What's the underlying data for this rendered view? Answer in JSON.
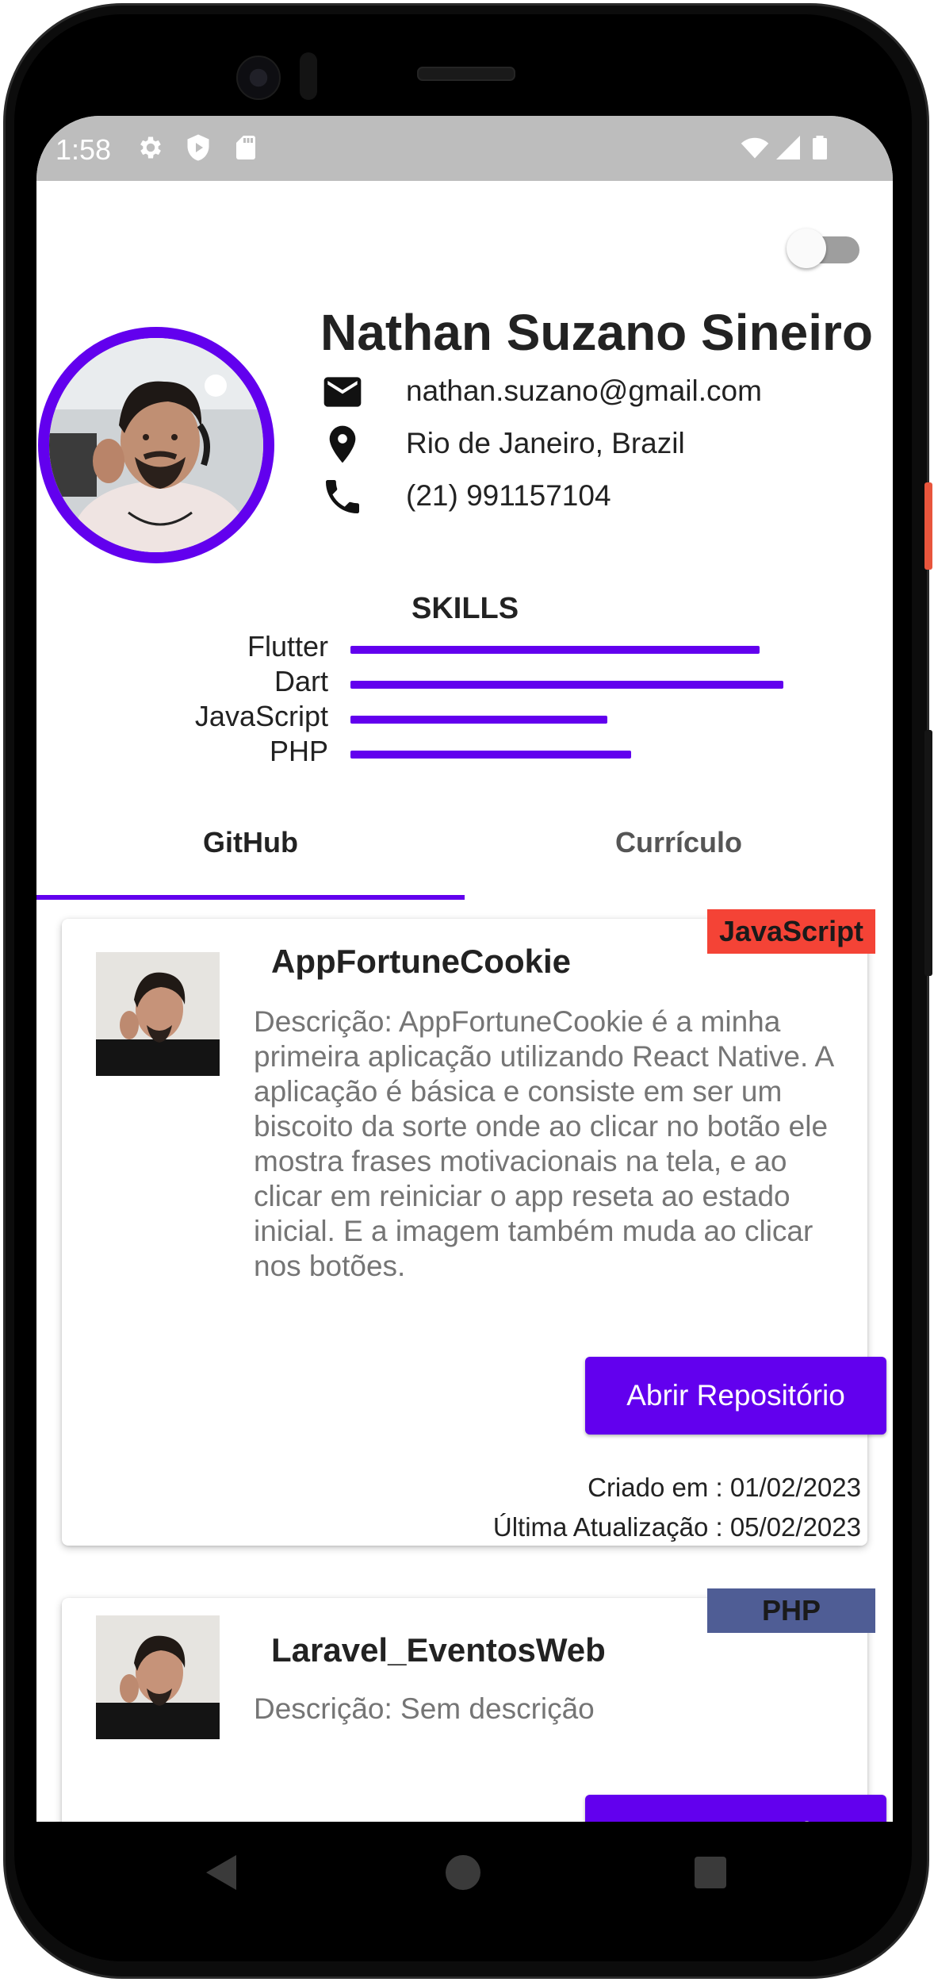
{
  "status_bar": {
    "time": "1:58",
    "left_icons": [
      "settings-icon",
      "shield-play-icon",
      "sd-card-icon"
    ],
    "right_icons": [
      "wifi-icon",
      "signal-icon",
      "battery-icon"
    ]
  },
  "theme_toggle": {
    "on": false
  },
  "profile": {
    "name": "Nathan Suzano Sineiro",
    "email": "nathan.suzano@gmail.com",
    "location": "Rio de Janeiro, Brazil",
    "phone": "(21) 991157104"
  },
  "skills": {
    "title": "SKILLS",
    "items": [
      {
        "label": "Flutter",
        "level": 0.86
      },
      {
        "label": "Dart",
        "level": 0.91
      },
      {
        "label": "JavaScript",
        "level": 0.54
      },
      {
        "label": "PHP",
        "level": 0.59
      }
    ]
  },
  "tabs": [
    {
      "label": "GitHub",
      "active": true
    },
    {
      "label": "Currículo",
      "active": false
    }
  ],
  "repos": [
    {
      "title": "AppFortuneCookie",
      "language": "JavaScript",
      "language_color": "#f44336",
      "description": "Descrição: AppFortuneCookie é a minha primeira aplicação utilizando React Native.  A aplicação é básica e consiste em ser um biscoito da sorte onde ao clicar no botão ele mostra frases motivacionais na tela, e ao clicar em reiniciar o app reseta ao estado inicial. E a imagem também muda ao clicar nos botões.",
      "button": "Abrir Repositório",
      "created": "Criado em : 01/02/2023",
      "updated": "Última Atualização : 05/02/2023"
    },
    {
      "title": "Laravel_EventosWeb",
      "language": "PHP",
      "language_color": "#4f5d95",
      "description": "Descrição: Sem descrição",
      "button": "Abrir Repositório"
    }
  ],
  "colors": {
    "accent": "#6200ee",
    "status_bar": "#bdbdbd"
  }
}
